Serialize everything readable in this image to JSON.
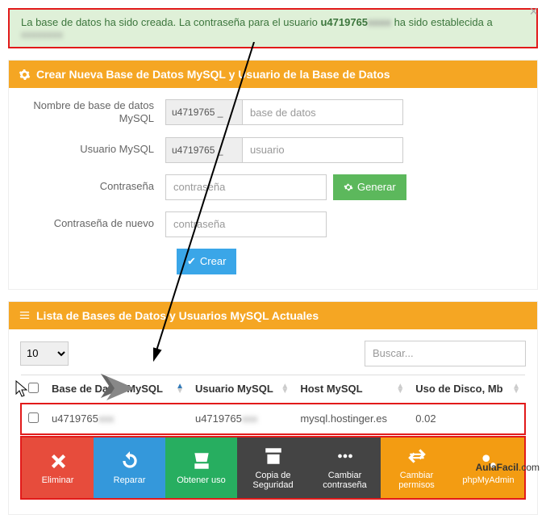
{
  "alert": {
    "t1": "La base de datos ha sido creada. La contraseña para el usuario ",
    "user": "u4719765",
    "blur1": "xxxx",
    "t2": " ha sido establecida a ",
    "blur2": "xxxxxxxx"
  },
  "create": {
    "title": "Crear Nueva Base de Datos MySQL y Usuario de la Base de Datos",
    "dbname_label": "Nombre de base de datos MySQL",
    "user_label": "Usuario MySQL",
    "pass_label": "Contraseña",
    "pass2_label": "Contraseña de nuevo",
    "prefix": "u4719765 _",
    "ph_db": "base de datos",
    "ph_user": "usuario",
    "ph_pass": "contraseña",
    "gen": "Generar",
    "submit": "Crear"
  },
  "list": {
    "title": "Lista de Bases de Datos y Usuarios MySQL Actuales",
    "per_page": "10",
    "search_ph": "Buscar...",
    "cols": {
      "db": "Base de Datos MySQL",
      "user": "Usuario MySQL",
      "host": "Host MySQL",
      "disk": "Uso de Disco, Mb"
    },
    "row": {
      "db": "u4719765",
      "user": "u4719765",
      "host": "mysql.hostinger.es",
      "disk": "0.02"
    }
  },
  "actions": {
    "del": "Eliminar",
    "rep": "Reparar",
    "use": "Obtener uso",
    "bak": "Copia de Seguridad",
    "pwd": "Cambiar contraseña",
    "perm": "Cambiar permisos",
    "pma": "phpMyAdmin"
  },
  "brand": {
    "a": "AulaFacil",
    "b": ".com"
  }
}
